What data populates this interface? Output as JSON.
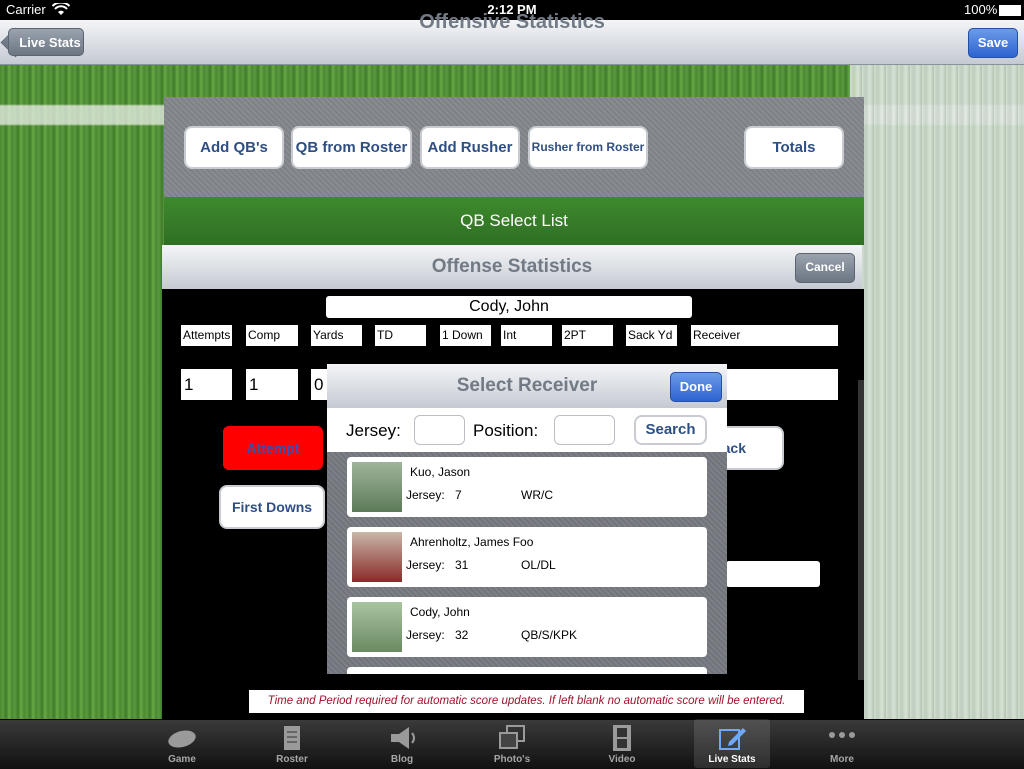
{
  "status_bar": {
    "carrier": "Carrier",
    "time": "2:12 PM",
    "battery": "100%"
  },
  "nav": {
    "title": "Offensive Statistics",
    "back_label": "Live Stats",
    "save_label": "Save"
  },
  "toolbar": {
    "add_qbs": "Add QB's",
    "qb_from_roster": "QB from Roster",
    "add_rusher": "Add Rusher",
    "rusher_from_roster": "Rusher from Roster",
    "totals": "Totals"
  },
  "qb_select_list": "QB Select List",
  "offense": {
    "title": "Offense Statistics",
    "cancel_label": "Cancel",
    "player_name": "Cody, John",
    "labels": [
      "Attempts",
      "Comp",
      "Yards",
      "TD",
      "1 Down",
      "Int",
      "2PT",
      "Sack Yd",
      "Receiver"
    ],
    "values": [
      "1",
      "1",
      "0"
    ],
    "attempt_label": "Attempt",
    "first_downs_label": "First Downs",
    "back_partial": "ack",
    "note": "Time and Period required for automatic score updates. If left blank no automatic score will be entered."
  },
  "popover": {
    "title": "Select Receiver",
    "done_label": "Done",
    "jersey_label": "Jersey:",
    "position_label": "Position:",
    "search_label": "Search",
    "jersey_prefix": "Jersey:",
    "players": [
      {
        "name": "Kuo, Jason",
        "jersey": "7",
        "position": "WR/C"
      },
      {
        "name": "Ahrenholtz, James Foo",
        "jersey": "31",
        "position": "OL/DL"
      },
      {
        "name": "Cody, John",
        "jersey": "32",
        "position": "QB/S/KPK"
      }
    ]
  },
  "tabs": [
    {
      "label": "Game",
      "icon": "football-icon"
    },
    {
      "label": "Roster",
      "icon": "document-icon"
    },
    {
      "label": "Blog",
      "icon": "megaphone-icon"
    },
    {
      "label": "Photo's",
      "icon": "photos-icon"
    },
    {
      "label": "Video",
      "icon": "film-icon"
    },
    {
      "label": "Live Stats",
      "icon": "edit-icon",
      "active": true
    },
    {
      "label": "More",
      "icon": "more-icon"
    }
  ],
  "colors": {
    "accent_blue": "#2d63d1",
    "attempt_red": "#ff0000",
    "note_red": "#a0122a",
    "button_text": "#2f4f83"
  }
}
